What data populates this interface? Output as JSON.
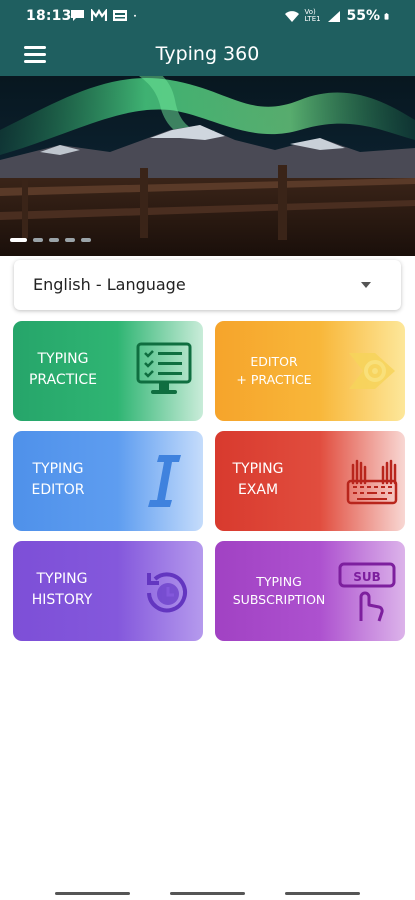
{
  "status_bar": {
    "time": "18:13",
    "network_label": "Vo) LTE1",
    "battery": "55%"
  },
  "app_bar": {
    "title": "Typing 360",
    "menu_icon": "hamburger-menu-icon"
  },
  "banner": {
    "slides_total": 5,
    "active_slide": 1
  },
  "language_select": {
    "value": "English - Language"
  },
  "tiles": [
    {
      "line1": "TYPING",
      "line2": "PRACTICE",
      "icon": "monitor-checklist-icon",
      "color": "#2fb573"
    },
    {
      "line1": "EDITOR",
      "line2": "+ PRACTICE",
      "icon": "arrow-target-icon",
      "color": "#f8b73a"
    },
    {
      "line1": "TYPING",
      "line2": "EDITOR",
      "icon": "text-cursor-icon",
      "color": "#5e9df0"
    },
    {
      "line1": "TYPING",
      "line2": "EXAM",
      "icon": "hands-keyboard-icon",
      "color": "#e14d3e"
    },
    {
      "line1": "TYPING",
      "line2": "HISTORY",
      "icon": "history-clock-icon",
      "color": "#8458dc"
    },
    {
      "line1": "TYPING",
      "line2": "SUBSCRIPTION",
      "icon": "sub-button-tap-icon",
      "icon_text": "SUB",
      "color": "#ad51cf"
    }
  ]
}
